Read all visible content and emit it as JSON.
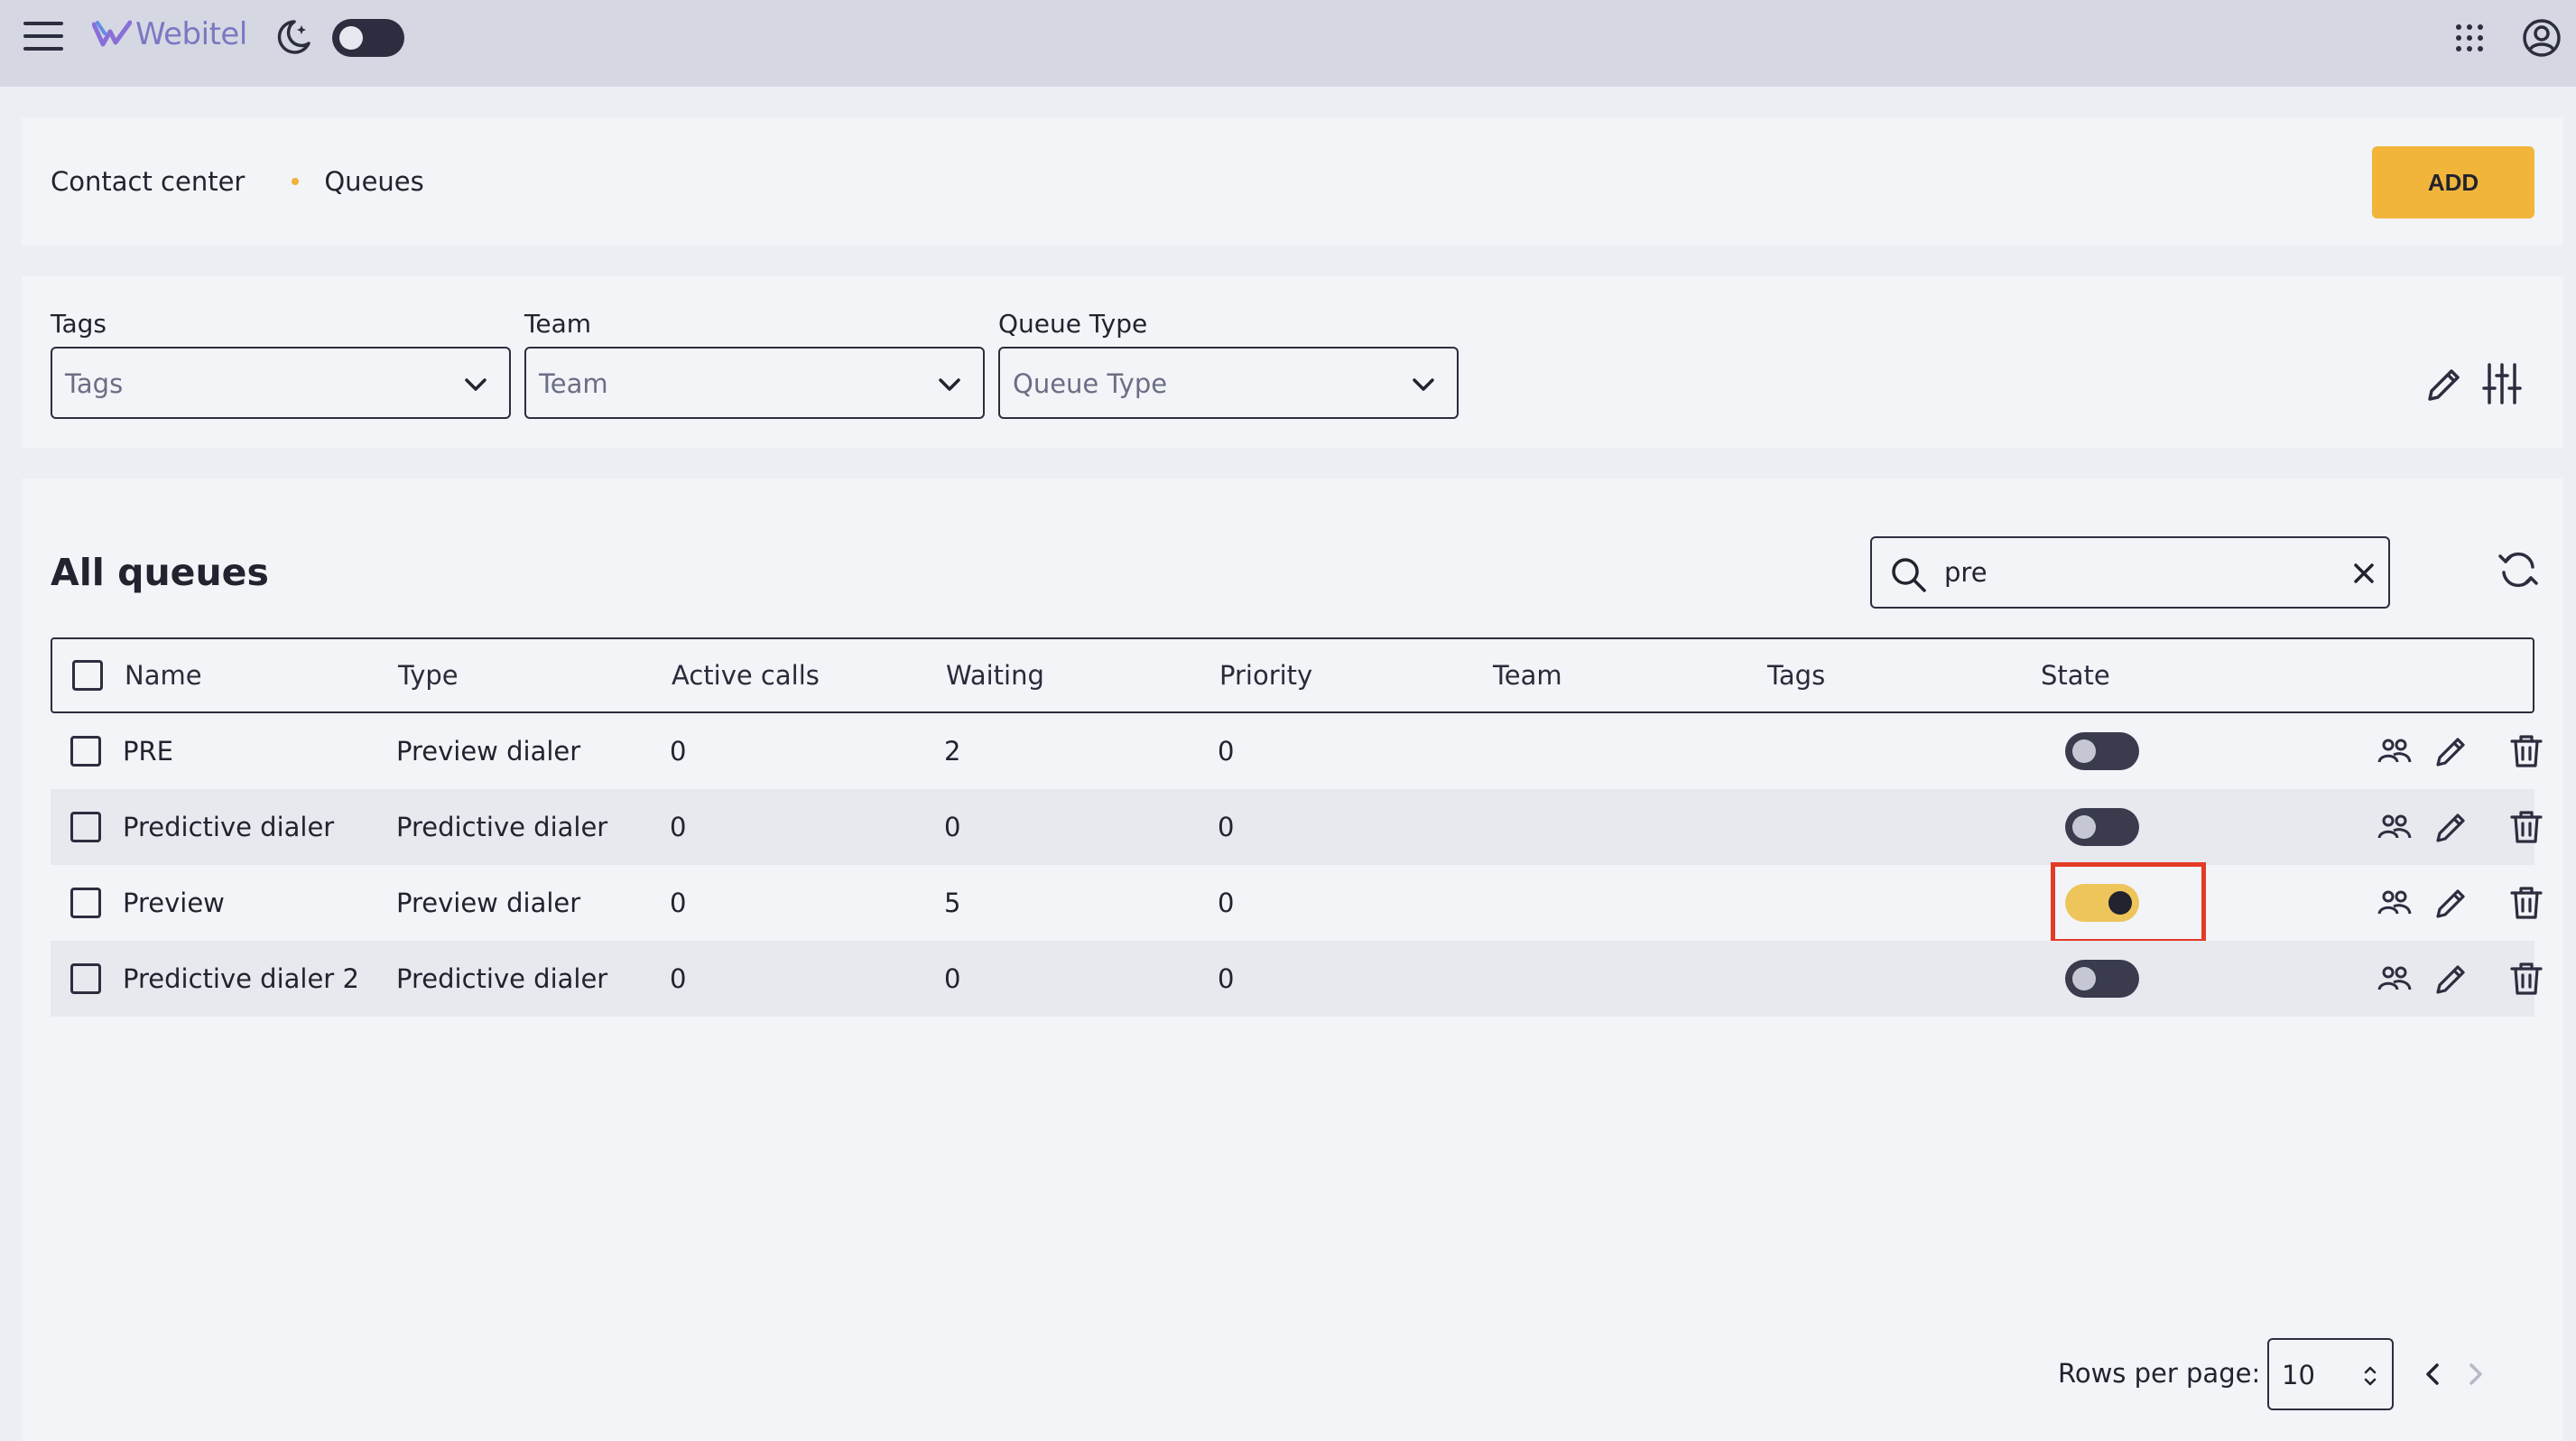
{
  "header": {
    "logo_text": "Webitel",
    "icons": [
      "menu-icon",
      "moon-icon",
      "apps-grid-icon",
      "account-icon"
    ]
  },
  "breadcrumb": {
    "items": [
      "Contact center",
      "Queues"
    ]
  },
  "actions": {
    "add_label": "ADD"
  },
  "filters": [
    {
      "label": "Tags",
      "placeholder": "Tags"
    },
    {
      "label": "Team",
      "placeholder": "Team"
    },
    {
      "label": "Queue Type",
      "placeholder": "Queue Type"
    }
  ],
  "table": {
    "title": "All queues",
    "search_value": "pre",
    "columns": [
      "Name",
      "Type",
      "Active calls",
      "Waiting",
      "Priority",
      "Team",
      "Tags",
      "State"
    ],
    "rows": [
      {
        "name": "PRE",
        "type": "Preview dialer",
        "active_calls": "0",
        "waiting": "2",
        "priority": "0",
        "team": "",
        "tags": "",
        "state": false
      },
      {
        "name": "Predictive dialer",
        "type": "Predictive dialer",
        "active_calls": "0",
        "waiting": "0",
        "priority": "0",
        "team": "",
        "tags": "",
        "state": false
      },
      {
        "name": "Preview",
        "type": "Preview dialer",
        "active_calls": "0",
        "waiting": "5",
        "priority": "0",
        "team": "",
        "tags": "",
        "state": true
      },
      {
        "name": "Predictive dialer 2",
        "type": "Predictive dialer",
        "active_calls": "0",
        "waiting": "0",
        "priority": "0",
        "team": "",
        "tags": "",
        "state": false
      }
    ],
    "row_actions": [
      "members-icon",
      "edit-icon",
      "delete-icon"
    ]
  },
  "pagination": {
    "rows_per_page_label": "Rows per page:",
    "rows_per_page": "10"
  },
  "colors": {
    "accent": "#f1b53a",
    "toggle_on": "#eec55a",
    "toggle_off": "#3a3c4e",
    "highlight": "#e43b25",
    "header_bg": "#d5d8e3"
  }
}
